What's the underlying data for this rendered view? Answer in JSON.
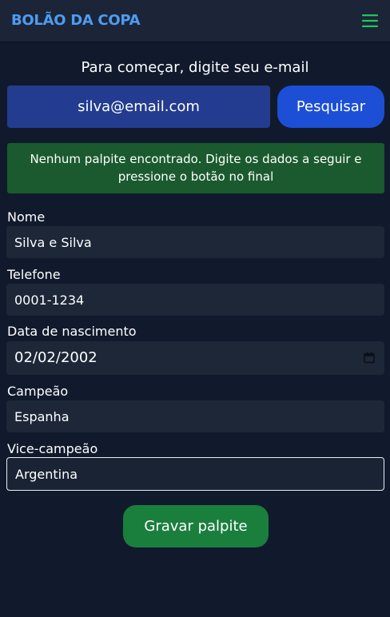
{
  "header": {
    "brand": "BOLÃO DA COPA",
    "menu_icon": "hamburger-menu-icon",
    "brand_color": "#4d9cf2",
    "menu_color": "#22c55e"
  },
  "search": {
    "heading": "Para começar, digite seu e-mail",
    "email_value": "silva@email.com",
    "button_label": "Pesquisar"
  },
  "alert": {
    "message": "Nenhum palpite encontrado. Digite os dados a seguir e pressione o botão no final"
  },
  "form": {
    "name_label": "Nome",
    "name_value": "Silva e Silva",
    "phone_label": "Telefone",
    "phone_value": "0001-1234",
    "birthdate_label": "Data de nascimento",
    "birthdate_value": "02/02/2002",
    "calendar_icon": "calendar-icon",
    "champion_label": "Campeão",
    "champion_value": "Espanha",
    "runner_up_label": "Vice-campeão",
    "runner_up_value": "Argentina",
    "submit_label": "Gravar palpite"
  },
  "colors": {
    "background": "#111a2c",
    "email_input": "#233c8f",
    "search_button": "#1c4fd6",
    "alert_success": "#1a5a2e",
    "submit_button": "#1a7f3d"
  }
}
